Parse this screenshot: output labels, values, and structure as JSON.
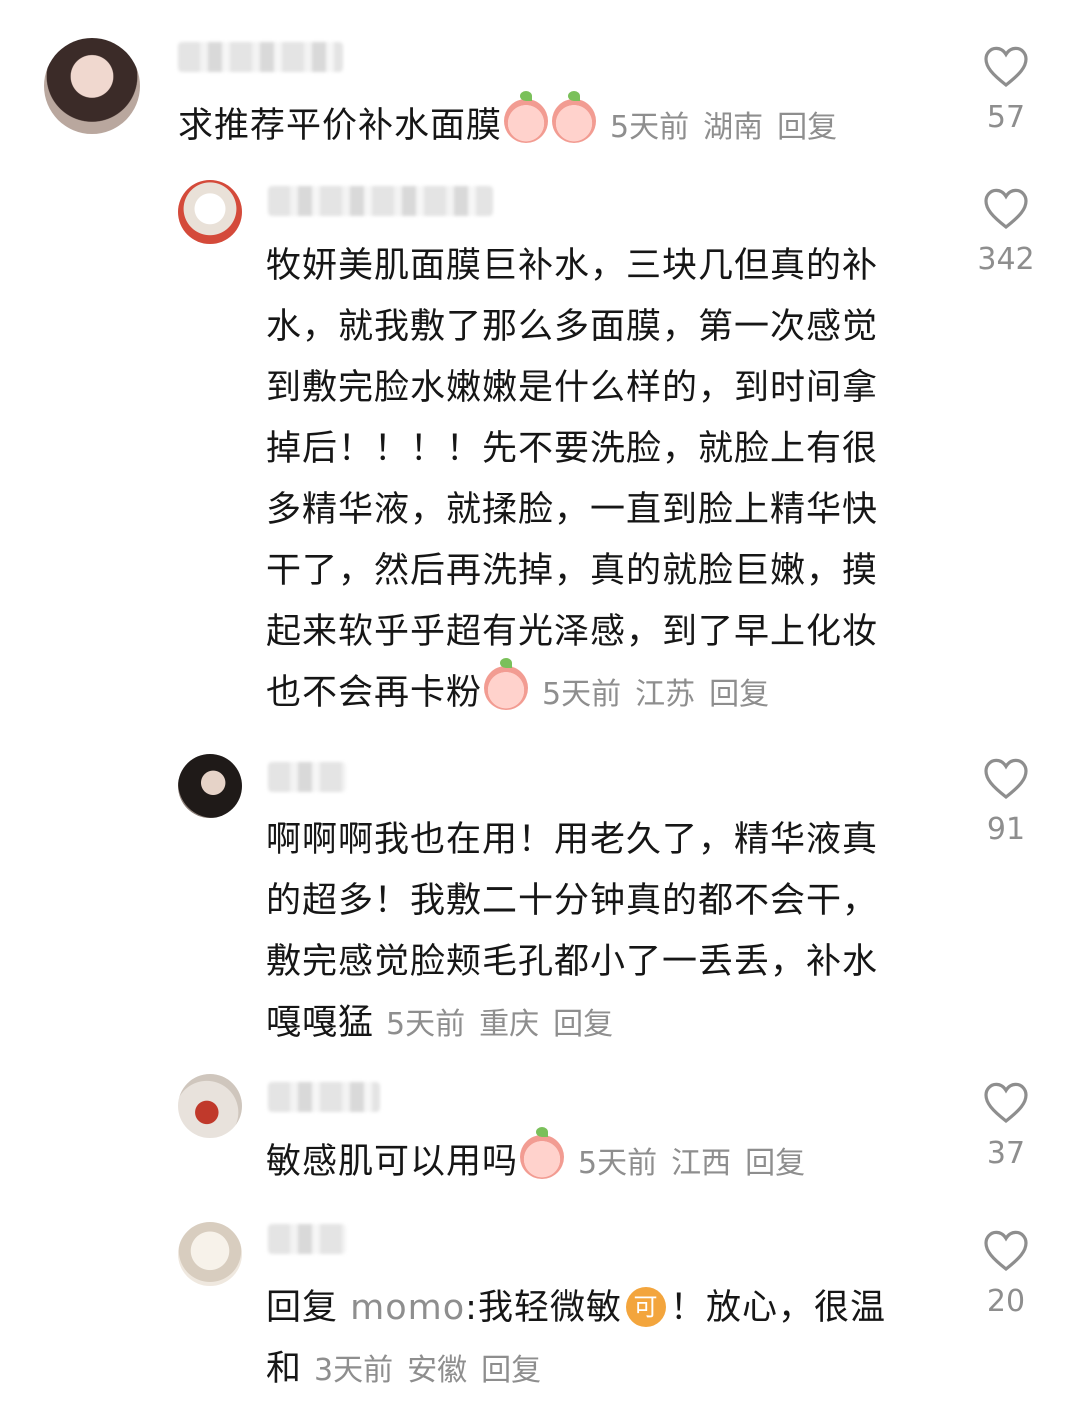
{
  "comments": [
    {
      "text": "求推荐平价补水面膜",
      "emojis": [
        "crying-peach-emoji",
        "crying-peach-emoji"
      ],
      "time": "5天前",
      "location": "湖南",
      "reply_label": "回复",
      "likes": "57",
      "avatar": "girl-portrait-avatar"
    },
    {
      "lines": [
        "牧妍美肌面膜巨补水，三块几但真的补",
        "水，就我敷了那么多面膜，第一次感觉",
        "到敷完脸水嫩嫩是什么样的，到时间拿",
        "掉后！！！！先不要洗脸，就脸上有很",
        "多精华液，就揉脸，一直到脸上精华快",
        "干了，然后再洗掉，真的就脸巨嫩，摸",
        "起来软乎乎超有光泽感，到了早上化妆"
      ],
      "last_line": "也不会再卡粉",
      "emojis": [
        "shocked-peach-emoji"
      ],
      "time": "5天前",
      "location": "江苏",
      "reply_label": "回复",
      "likes": "342",
      "avatar": "plush-toy-avatar"
    },
    {
      "lines": [
        "啊啊啊我也在用！用老久了，精华液真",
        "的超多！我敷二十分钟真的都不会干，",
        "敷完感觉脸颊毛孔都小了一丢丢，补水"
      ],
      "last_line": "嘎嘎猛",
      "time": "5天前",
      "location": "重庆",
      "reply_label": "回复",
      "likes": "91",
      "avatar": "dark-portrait-avatar"
    },
    {
      "text": "敏感肌可以用吗",
      "emojis": [
        "crying-peach-emoji"
      ],
      "time": "5天前",
      "location": "江西",
      "reply_label": "回复",
      "likes": "37",
      "avatar": "red-object-avatar"
    },
    {
      "reply_prefix": "回复",
      "reply_to": "momo",
      "line1_text": ":我轻微敏",
      "badge": "可",
      "line1_rest": "！放心，很温",
      "last_line": "和",
      "time": "3天前",
      "location": "安徽",
      "reply_label": "回复",
      "likes": "20",
      "avatar": "sketch-avatar"
    }
  ]
}
